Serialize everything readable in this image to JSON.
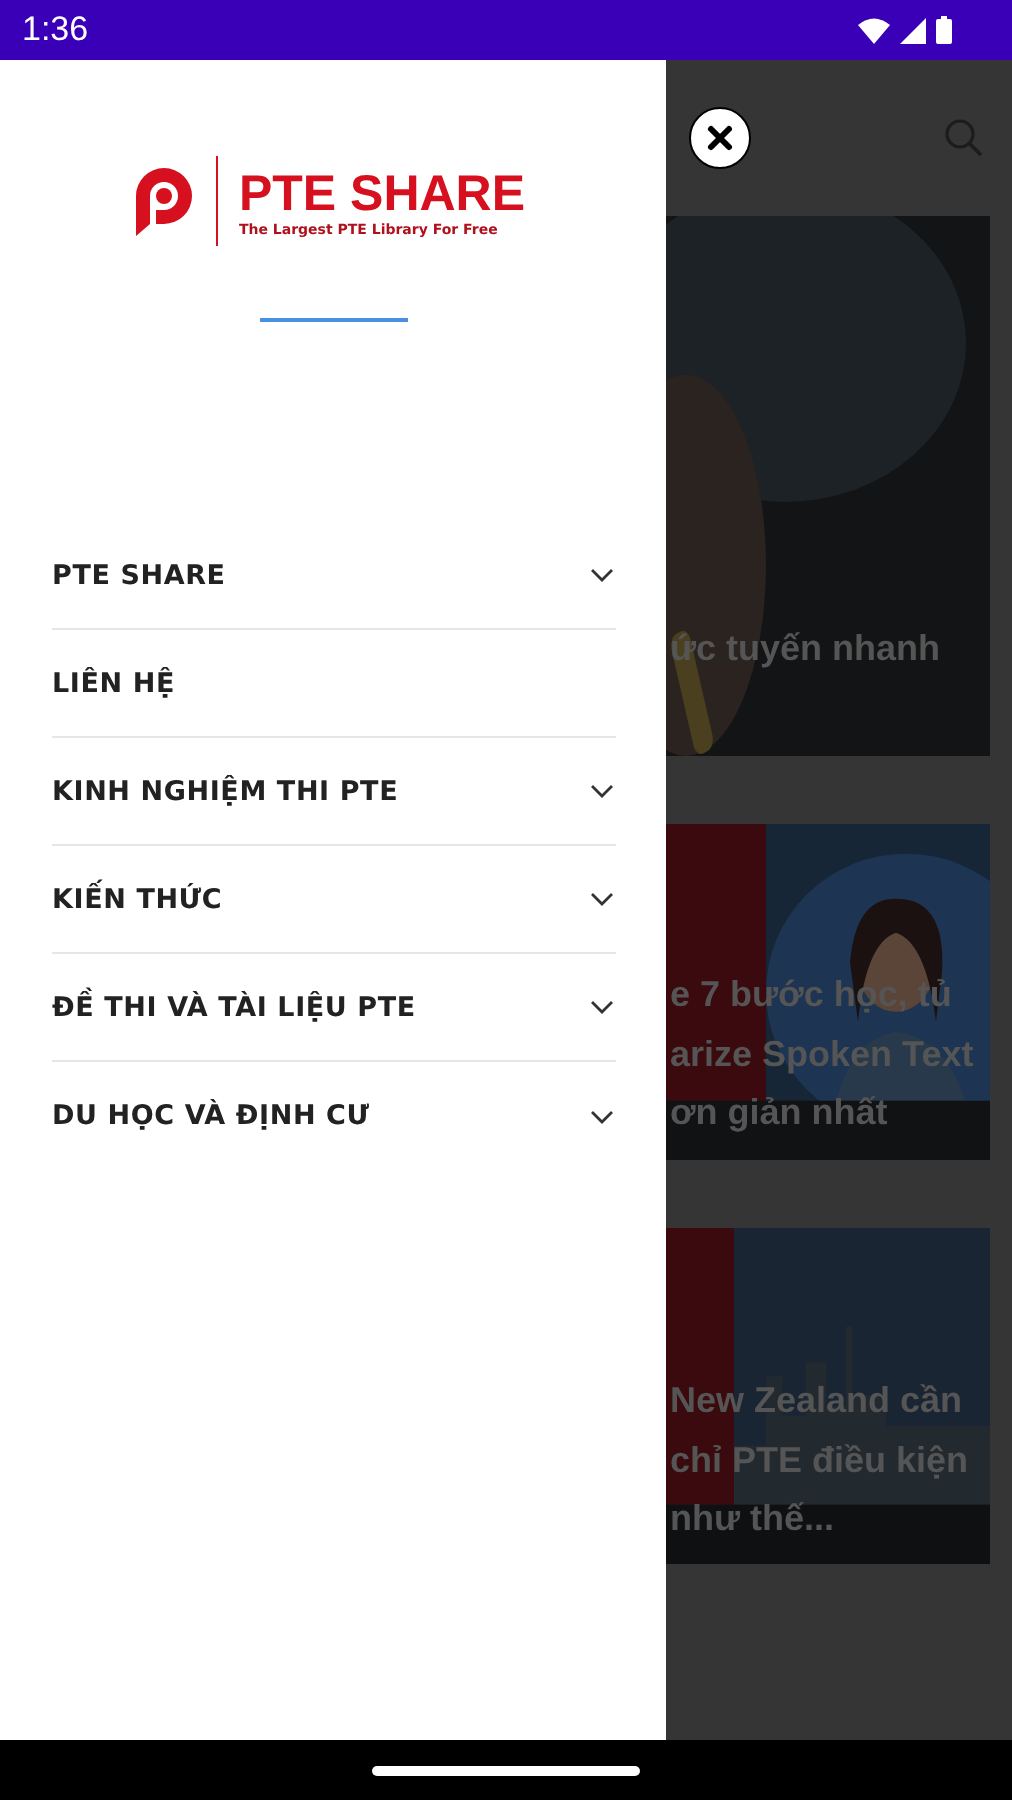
{
  "status_bar": {
    "time": "1:36"
  },
  "drawer": {
    "logo": {
      "title": "PTE SHARE",
      "tagline": "The Largest PTE Library For Free"
    },
    "menu": [
      {
        "label": "PTE SHARE",
        "expandable": true
      },
      {
        "label": "LIÊN HỆ",
        "expandable": false
      },
      {
        "label": "KINH NGHIỆM THI PTE",
        "expandable": true
      },
      {
        "label": "KIẾN THỨC",
        "expandable": true
      },
      {
        "label": "ĐỀ THI VÀ TÀI LIỆU PTE",
        "expandable": true
      },
      {
        "label": "DU HỌC VÀ ĐỊNH CƯ",
        "expandable": true
      }
    ]
  },
  "background": {
    "cards": [
      {
        "kind": "study",
        "title": "ức tuyến nhanh"
      },
      {
        "kind": "person",
        "title": "e 7 bước học, tủ\narize Spoken Text\nơn giản nhất"
      },
      {
        "kind": "city",
        "title": "New Zealand cần\nchỉ PTE điều kiện\nnhư thế..."
      }
    ]
  }
}
